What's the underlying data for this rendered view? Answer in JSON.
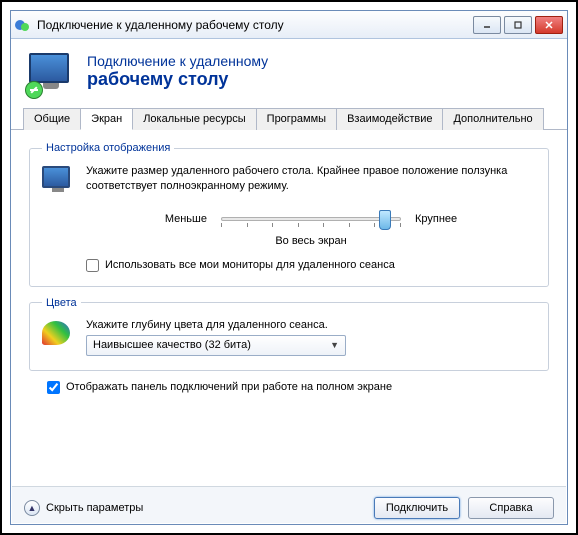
{
  "window": {
    "title": "Подключение к удаленному рабочему столу"
  },
  "header": {
    "line1": "Подключение к удаленному",
    "line2": "рабочему столу"
  },
  "tabs": [
    "Общие",
    "Экран",
    "Локальные ресурсы",
    "Программы",
    "Взаимодействие",
    "Дополнительно"
  ],
  "active_tab": 1,
  "display_section": {
    "legend": "Настройка отображения",
    "description": "Укажите размер удаленного рабочего стола. Крайнее правое положение ползунка соответствует полноэкранному режиму.",
    "slider_min_label": "Меньше",
    "slider_max_label": "Крупнее",
    "slider_value_label": "Во весь экран",
    "multi_monitor_label": "Использовать все мои мониторы для удаленного сеанса",
    "multi_monitor_checked": false
  },
  "color_section": {
    "legend": "Цвета",
    "description": "Укажите глубину цвета для удаленного сеанса.",
    "combo_value": "Наивысшее качество (32 бита)"
  },
  "connection_bar": {
    "label": "Отображать панель подключений при работе на полном экране",
    "checked": true
  },
  "footer": {
    "collapse_label": "Скрыть параметры",
    "connect": "Подключить",
    "help": "Справка"
  }
}
